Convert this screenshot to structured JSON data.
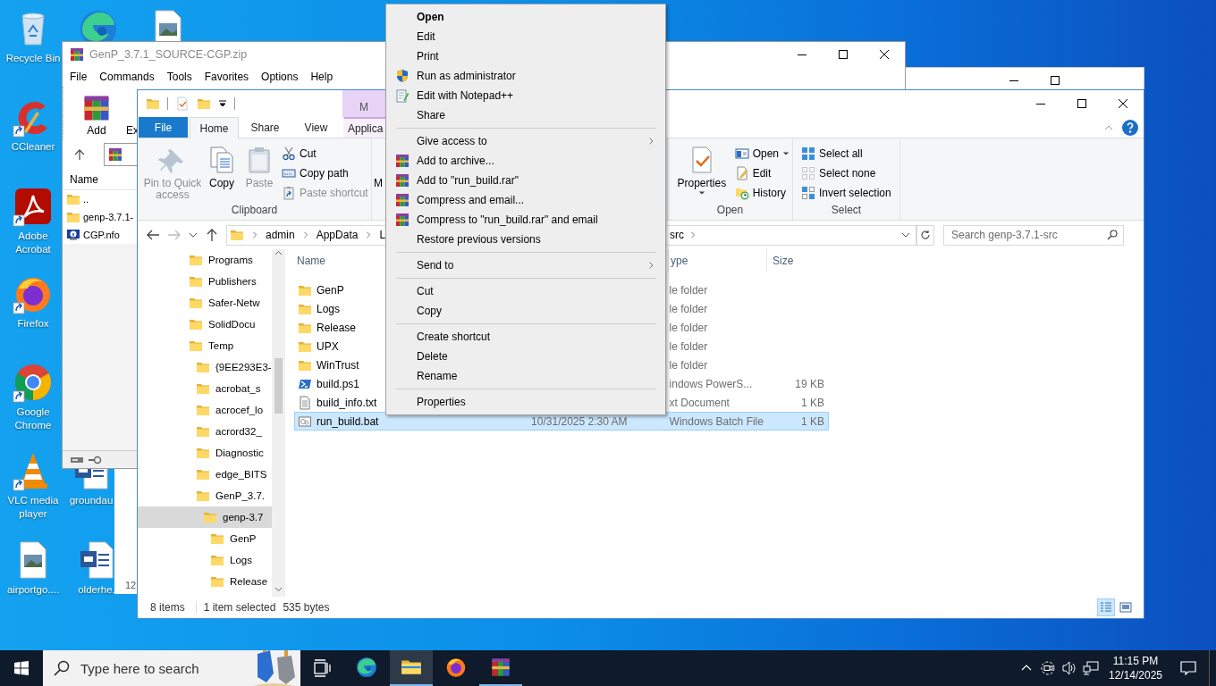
{
  "desktop": {
    "icons": [
      {
        "kind": "recycle",
        "label": "Recycle Bin",
        "shortcut": false
      },
      {
        "kind": "edge",
        "shortcut": false
      },
      {
        "kind": "image",
        "shortcut": false
      },
      {
        "kind": "ccleaner",
        "label": "CCleaner",
        "shortcut": true
      },
      {
        "kind": "acrobat",
        "label": "Adobe Acrobat",
        "shortcut": true
      },
      {
        "kind": "firefox",
        "label": "Firefox",
        "shortcut": true
      },
      {
        "kind": "chrome",
        "label": "Google Chrome",
        "shortcut": true
      },
      {
        "kind": "vlc",
        "label": "VLC media player",
        "shortcut": true
      },
      {
        "kind": "word",
        "label": "groundau",
        "shortcut": false
      },
      {
        "kind": "image",
        "label": "airportgo....",
        "shortcut": false
      },
      {
        "kind": "word",
        "label": "olderhe.",
        "shortcut": false
      }
    ]
  },
  "winrar": {
    "title": "GenP_3.7.1_SOURCE-CGP.zip",
    "menu": [
      "File",
      "Commands",
      "Tools",
      "Favorites",
      "Options",
      "Help"
    ],
    "toolbar": [
      "Add",
      "Ex"
    ],
    "column": "Name",
    "files": [
      {
        "name": "..",
        "kind": "folder"
      },
      {
        "name": "genp-3.7.1-",
        "kind": "folder"
      },
      {
        "name": "CGP.nfo",
        "kind": "nfo"
      }
    ]
  },
  "other_window": {
    "text": "12"
  },
  "explorer": {
    "context_header": "M",
    "tabs": [
      {
        "label": "File",
        "kind": "file",
        "selected": false
      },
      {
        "label": "Home",
        "kind": "tab",
        "selected": true
      },
      {
        "label": "Share",
        "kind": "tab",
        "selected": false
      },
      {
        "label": "View",
        "kind": "tab",
        "selected": false
      },
      {
        "label": "Applica",
        "kind": "context",
        "selected": false
      }
    ],
    "ribbon": {
      "groups": [
        {
          "label": "Clipboard",
          "large": [
            {
              "label": "Pin to Quick access",
              "kind": "pin",
              "disabled": true,
              "dropdown": false
            },
            {
              "label": "Copy",
              "kind": "copy",
              "disabled": false,
              "dropdown": false
            },
            {
              "label": "Paste",
              "kind": "paste",
              "disabled": true,
              "dropdown": false
            }
          ],
          "small": [
            {
              "label": "Cut",
              "kind": "cut",
              "disabled": false,
              "dropdown": false
            },
            {
              "label": "Copy path",
              "kind": "copypath",
              "disabled": false,
              "dropdown": false
            },
            {
              "label": "Paste shortcut",
              "kind": "pasteshortcut",
              "disabled": true,
              "dropdown": false
            }
          ]
        },
        {
          "large": [
            {
              "label": "M",
              "kind": "partial",
              "disabled": false,
              "dropdown": false
            }
          ]
        },
        {
          "label": "Open",
          "large": [
            {
              "label": "Properties",
              "kind": "properties",
              "disabled": false,
              "dropdown": true
            }
          ],
          "small": [
            {
              "label": "Open",
              "kind": "open",
              "disabled": false,
              "dropdown": true
            },
            {
              "label": "Edit",
              "kind": "edit",
              "disabled": false,
              "dropdown": false
            },
            {
              "label": "History",
              "kind": "history",
              "disabled": false,
              "dropdown": false
            }
          ]
        },
        {
          "label": "Select",
          "small": [
            {
              "label": "Select all",
              "kind": "selectall",
              "disabled": false,
              "dropdown": false
            },
            {
              "label": "Select none",
              "kind": "selectnone",
              "disabled": false,
              "dropdown": false
            },
            {
              "label": "Invert selection",
              "kind": "invert",
              "disabled": false,
              "dropdown": false
            }
          ]
        }
      ]
    },
    "address": {
      "crumbs": [
        "admin",
        "AppData",
        "L"
      ],
      "tail": "src"
    },
    "search": {
      "placeholder": "Search genp-3.7.1-src"
    },
    "nav": [
      {
        "label": "Programs",
        "selected": false
      },
      {
        "label": "Publishers",
        "selected": false
      },
      {
        "label": "Safer-Netw",
        "selected": false
      },
      {
        "label": "SolidDocu",
        "selected": false
      },
      {
        "label": "Temp",
        "selected": false,
        "children": [
          {
            "label": "{9EE293E3-",
            "selected": false
          },
          {
            "label": "acrobat_s",
            "selected": false
          },
          {
            "label": "acrocef_lo",
            "selected": false
          },
          {
            "label": "acrord32_",
            "selected": false
          },
          {
            "label": "Diagnostic",
            "selected": false
          },
          {
            "label": "edge_BITS",
            "selected": false
          },
          {
            "label": "GenP_3.7.",
            "selected": false,
            "children": [
              {
                "label": "genp-3.7",
                "selected": true,
                "children": [
                  {
                    "label": "GenP",
                    "selected": false
                  },
                  {
                    "label": "Logs",
                    "selected": false
                  },
                  {
                    "label": "Release",
                    "selected": false
                  }
                ]
              }
            ]
          }
        ]
      }
    ],
    "files": {
      "columns": {
        "name": "Name",
        "column_3": "ype",
        "size": "Size"
      },
      "rows": [
        {
          "name": "GenP",
          "kind": "folder",
          "column_3": "le folder",
          "selected": false
        },
        {
          "name": "Logs",
          "kind": "folder",
          "column_3": "le folder",
          "selected": false
        },
        {
          "name": "Release",
          "kind": "folder",
          "column_3": "le folder",
          "selected": false
        },
        {
          "name": "UPX",
          "kind": "folder",
          "column_3": "le folder",
          "selected": false
        },
        {
          "name": "WinTrust",
          "kind": "folder",
          "column_3": "le folder",
          "selected": false
        },
        {
          "name": "build.ps1",
          "kind": "ps1",
          "column_3": "indows PowerS...",
          "size": "19 KB",
          "selected": false
        },
        {
          "name": "build_info.txt",
          "kind": "txt",
          "column_3": "xt Document",
          "size": "1 KB",
          "selected": false
        },
        {
          "name": "run_build.bat",
          "kind": "bat",
          "column_2": "10/31/2025 2:30 AM",
          "column_3": "Windows Batch File",
          "size": "1 KB",
          "selected": true
        }
      ]
    },
    "status": {
      "count": "8 items",
      "selection": "1 item selected",
      "size": "535 bytes"
    },
    "views": [
      {
        "kind": "details",
        "selected": true
      },
      {
        "kind": "preview",
        "selected": false
      }
    ]
  },
  "context_menu": {
    "items": [
      {
        "kind": "default",
        "label": "Open"
      },
      {
        "kind": "item",
        "label": "Edit"
      },
      {
        "kind": "item",
        "label": "Print"
      },
      {
        "kind": "shield",
        "label": "Run as administrator"
      },
      {
        "kind": "notepad",
        "label": "Edit with Notepad++"
      },
      {
        "kind": "item",
        "label": "Share"
      },
      {
        "kind": "separator"
      },
      {
        "kind": "submenu",
        "label": "Give access to"
      },
      {
        "kind": "archive",
        "label": "Add to archive..."
      },
      {
        "kind": "archive",
        "label": "Add to \"run_build.rar\""
      },
      {
        "kind": "archive",
        "label": "Compress and email..."
      },
      {
        "kind": "archive",
        "label": "Compress to \"run_build.rar\" and email"
      },
      {
        "kind": "item",
        "label": "Restore previous versions"
      },
      {
        "kind": "separator"
      },
      {
        "kind": "submenu",
        "label": "Send to"
      },
      {
        "kind": "separator"
      },
      {
        "kind": "item",
        "label": "Cut"
      },
      {
        "kind": "item",
        "label": "Copy"
      },
      {
        "kind": "separator"
      },
      {
        "kind": "item",
        "label": "Create shortcut"
      },
      {
        "kind": "item",
        "label": "Delete"
      },
      {
        "kind": "item",
        "label": "Rename"
      },
      {
        "kind": "separator"
      },
      {
        "kind": "item",
        "label": "Properties"
      }
    ]
  },
  "taskbar": {
    "search": {
      "placeholder": "Type here to search"
    },
    "apps": [
      {
        "kind": "edge",
        "selected": false,
        "running": false
      },
      {
        "kind": "explorer",
        "selected": true,
        "running": true
      },
      {
        "kind": "firefox",
        "selected": false,
        "running": false
      },
      {
        "kind": "winrar",
        "selected": false,
        "running": true
      }
    ],
    "time": "11:15 PM",
    "date": "12/14/2025"
  }
}
